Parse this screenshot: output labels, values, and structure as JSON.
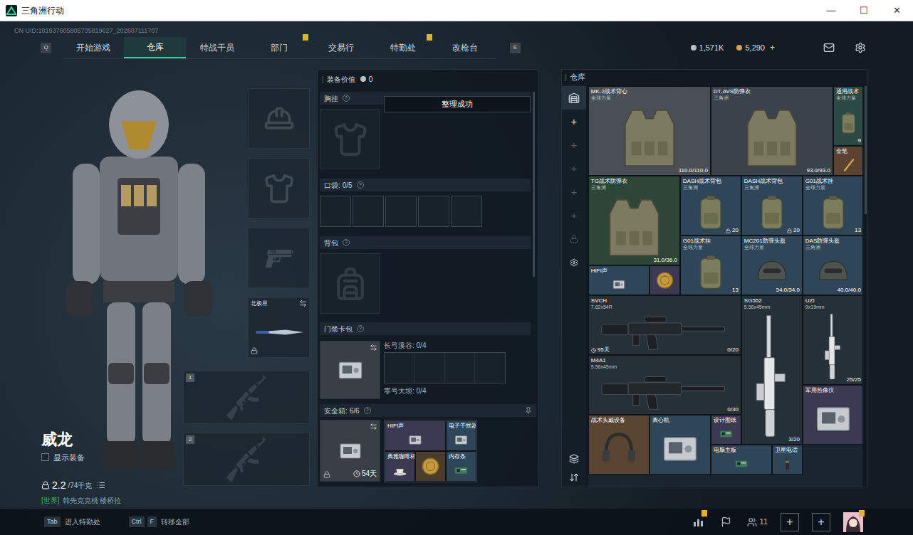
{
  "window": {
    "title": "三角洲行动",
    "controls": [
      "—",
      "☐",
      "✕"
    ]
  },
  "uid": "CN UID:181937605805735819627_202607111707",
  "nav": {
    "left_key": "Q",
    "right_key": "E",
    "tabs": [
      {
        "label": "开始游戏",
        "selected": false,
        "badge": false
      },
      {
        "label": "仓库",
        "selected": true,
        "badge": false
      },
      {
        "label": "特战干员",
        "selected": false,
        "badge": false
      },
      {
        "label": "部门",
        "selected": false,
        "badge": true
      },
      {
        "label": "交易行",
        "selected": false,
        "badge": false
      },
      {
        "label": "特勤处",
        "selected": false,
        "badge": true
      },
      {
        "label": "改枪台",
        "selected": false,
        "badge": false
      }
    ],
    "currency": [
      {
        "kind": "silver",
        "value": "1,571K"
      },
      {
        "kind": "gold",
        "value": "5,290",
        "add": "+"
      }
    ]
  },
  "character": {
    "name": "威龙",
    "show_equipment": {
      "label": "显示装备",
      "checked": false
    },
    "weight": "2.2",
    "weight_max": "/74千克",
    "chat": {
      "channel": "[世界]",
      "text": "韩先克克桃 楼桥拉"
    }
  },
  "slots": [
    {
      "kind": "helmet"
    },
    {
      "kind": "armor"
    },
    {
      "kind": "pistol"
    },
    {
      "kind": "melee",
      "label": "北极星",
      "locked": true
    }
  ],
  "weapon_slots": [
    {
      "number": "1"
    },
    {
      "number": "2"
    }
  ],
  "loadout": {
    "value_label": "装备价值",
    "value": "0",
    "toast": "整理成功",
    "chest": {
      "title": "胸挂",
      "help": "?"
    },
    "pockets": {
      "title": "口袋:",
      "count": "0/5",
      "help": "?",
      "slots": [
        {
          "filled": false
        },
        {
          "filled": false
        },
        {
          "filled": false
        },
        {
          "filled": false
        },
        {
          "filled": false
        }
      ]
    },
    "backpack": {
      "title": "背包",
      "help": "?"
    },
    "keycard": {
      "title": "门禁卡包",
      "help": "?",
      "maps": [
        {
          "label": "长弓溪谷: 0/4"
        },
        {
          "label": "零号大坝: 0/4"
        }
      ]
    },
    "safe": {
      "title": "安全箱:",
      "count": "6/6",
      "help": "?",
      "time": "54天",
      "locked": true,
      "items": [
        {
          "name": "HIFI声",
          "kind": "device",
          "color": "#3b3a52"
        },
        {
          "name": "电子干扰器",
          "kind": "device",
          "color": "#2f4658"
        },
        {
          "name": "典雅咖啡杯",
          "kind": "cup",
          "color": "#3b3a52"
        },
        {
          "kind": "coin",
          "color": "#4a3d2c"
        },
        {
          "name": "内存条",
          "kind": "chip",
          "color": "#2f4658"
        }
      ]
    }
  },
  "warehouse": {
    "title": "仓库",
    "sidebar": [
      {
        "kind": "home",
        "selected": true,
        "disabled": false
      },
      {
        "kind": "add",
        "label": "+",
        "selected": false,
        "disabled": false
      },
      {
        "kind": "add",
        "label": "+",
        "selected": false,
        "disabled": true
      },
      {
        "kind": "add",
        "label": "+",
        "selected": false,
        "disabled": true
      },
      {
        "kind": "add",
        "label": "+",
        "selected": false,
        "disabled": true
      },
      {
        "kind": "add",
        "label": "+",
        "selected": false,
        "disabled": true
      },
      {
        "kind": "lock",
        "selected": false,
        "disabled": true
      },
      {
        "kind": "settings",
        "selected": false,
        "disabled": false
      }
    ],
    "tools": [
      {
        "kind": "layers"
      },
      {
        "kind": "sort"
      }
    ],
    "items": [
      {
        "name": "MK-2战术背心",
        "sub": "全球力量",
        "count": "110.0/110.0",
        "kind": "armor",
        "color": "#4a4f56"
      },
      {
        "name": "DT-AVS防弹衣",
        "sub": "三角洲",
        "count": "93.0/93.0",
        "kind": "armor",
        "color": "#3a424b"
      },
      {
        "name": "通用战术",
        "sub": "全球力量",
        "count": "9",
        "kind": "bag",
        "color": "#2c4a45"
      },
      {
        "name": "金笔",
        "kind": "pen",
        "color": "#5a4330"
      },
      {
        "name": "TG战术防弹衣",
        "sub": "三角洲",
        "count": "31.0/36.0",
        "kind": "armor",
        "color": "#2e4637"
      },
      {
        "name": "DASH战术背包",
        "sub": "三角洲",
        "count": "20",
        "locked": true,
        "kind": "bag",
        "color": "#2f4658"
      },
      {
        "name": "DASH战术背包",
        "sub": "三角洲",
        "count": "20",
        "locked": true,
        "kind": "bag",
        "color": "#2f4658"
      },
      {
        "name": "G01战术挂",
        "sub": "全球力量",
        "count": "13",
        "kind": "bag",
        "color": "#2f4658"
      },
      {
        "name": "HIFI声",
        "kind": "device",
        "color": "#2f4658"
      },
      {
        "kind": "coin",
        "color": "#3b3a52"
      },
      {
        "name": "G01战术挂",
        "sub": "全球力量",
        "count": "13",
        "kind": "bag",
        "color": "#2f4658"
      },
      {
        "name": "MC201防弹头盔",
        "sub": "全球力量",
        "count": "34.0/34.0",
        "kind": "helmet",
        "color": "#2f4658"
      },
      {
        "name": "DAS防弹头盔",
        "sub": "三角洲",
        "count": "40.0/40.0",
        "kind": "helmet",
        "color": "#2f4658"
      },
      {
        "name": "SVCH",
        "sub": "7.62x54R",
        "count": "0/20",
        "days": "95天",
        "kind": "gun",
        "color": "#263038"
      },
      {
        "name": "SG552",
        "sub": "5.56x45mm",
        "count": "3/20",
        "kind": "gun_v",
        "color": "#263038"
      },
      {
        "name": "UZI",
        "sub": "9x19mm",
        "count": "25/25",
        "kind": "gun_v",
        "color": "#263038"
      },
      {
        "name": "M4A1",
        "sub": "5.56x45mm",
        "count": "0/30",
        "kind": "gun",
        "color": "#263038"
      },
      {
        "name": "军用热像仪",
        "kind": "device",
        "color": "#3b3a52"
      },
      {
        "name": "战术头戴设备",
        "kind": "headset",
        "color": "#5a4530"
      },
      {
        "name": "离心机",
        "kind": "device",
        "color": "#2f4658"
      },
      {
        "name": "设计图纸",
        "kind": "chip",
        "color": "#3b3a52"
      },
      {
        "name": "电脑主板",
        "kind": "chip",
        "color": "#2f4658"
      },
      {
        "name": "卫星电话",
        "kind": "phone",
        "color": "#2f4658"
      }
    ]
  },
  "bottom": {
    "hints": [
      {
        "keys": [
          "Tab"
        ],
        "label": "进入特勤处"
      },
      {
        "keys": [
          "Ctrl",
          "F"
        ],
        "label": "转移全部"
      }
    ],
    "buttons": [
      {
        "kind": "stats",
        "badge": true
      },
      {
        "kind": "flag",
        "badge": false
      },
      {
        "kind": "friends",
        "label": "11",
        "badge": false
      },
      {
        "kind": "add",
        "label": "+",
        "badge": false
      },
      {
        "kind": "add",
        "label": "+",
        "badge": false
      },
      {
        "kind": "avatar",
        "badge": true
      }
    ]
  }
}
